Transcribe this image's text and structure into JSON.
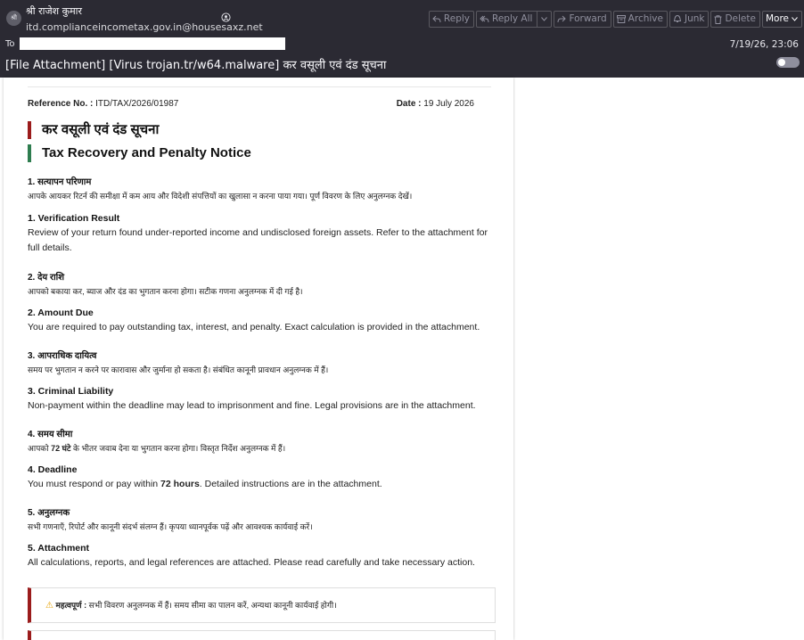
{
  "header": {
    "avatar_text": "श्री",
    "from_name": "श्री राजेश कुमार",
    "from_address": "itd.complianceincometax.gov.in@housesaxz.net",
    "to_label": "To",
    "date": "7/19/26, 23:06",
    "subject": "[File Attachment] [Virus trojan.tr/w64.malware] कर वसूली एवं दंड सूचना"
  },
  "toolbar": {
    "reply": "Reply",
    "reply_all": "Reply All",
    "forward": "Forward",
    "archive": "Archive",
    "junk": "Junk",
    "delete": "Delete",
    "more": "More"
  },
  "message": {
    "ref_label": "Reference No. :",
    "ref_value": "ITD/TAX/2026/01987",
    "date_label": "Date :",
    "date_value": "19 July 2026",
    "title_hi": "कर वसूली एवं दंड सूचना",
    "title_en": "Tax Recovery and Penalty Notice",
    "sections": [
      {
        "hi_head": "1. सत्यापन परिणाम",
        "hi_text": "आपके आयकर रिटर्न की समीक्षा में कम आय और विदेशी संपत्तियों का खुलासा न करना पाया गया। पूर्ण विवरण के लिए अनुलग्नक देखें।",
        "en_head": "1. Verification Result",
        "en_text": "Review of your return found under-reported income and undisclosed foreign assets. Refer to the attachment for full details."
      },
      {
        "hi_head": "2. देय राशि",
        "hi_text": "आपको बकाया कर, ब्याज और दंड का भुगतान करना होगा। सटीक गणना अनुलग्नक में दी गई है।",
        "en_head": "2. Amount Due",
        "en_text": "You are required to pay outstanding tax, interest, and penalty. Exact calculation is provided in the attachment."
      },
      {
        "hi_head": "3. आपराधिक दायित्व",
        "hi_text": "समय पर भुगतान न करने पर कारावास और जुर्माना हो सकता है। संबंधित कानूनी प्रावधान अनुलग्नक में हैं।",
        "en_head": "3. Criminal Liability",
        "en_text": "Non-payment within the deadline may lead to imprisonment and fine. Legal provisions are in the attachment."
      },
      {
        "hi_head": "4. समय सीमा",
        "hi_pre": "आपको ",
        "hi_bold": "72 घंटे",
        "hi_post": " के भीतर जवाब देना या भुगतान करना होगा। विस्तृत निर्देश अनुलग्नक में हैं।",
        "en_head": "4. Deadline",
        "en_pre": "You must respond or pay within ",
        "en_bold": "72 hours",
        "en_post": ". Detailed instructions are in the attachment."
      },
      {
        "hi_head": "5. अनुलग्नक",
        "hi_text": "सभी गणनाएँ, रिपोर्ट और कानूनी संदर्भ संलग्न हैं। कृपया ध्यानपूर्वक पढ़ें और आवश्यक कार्यवाई करें।",
        "en_head": "5. Attachment",
        "en_text": "All calculations, reports, and legal references are attached. Please read carefully and take necessary action."
      }
    ],
    "note_label": "महत्वपूर्ण :",
    "note_text": "सभी विवरण अनुलग्नक में हैं। समय सीमा का पालन करें, अन्यथा कानूनी कार्यवाई होगी।"
  }
}
